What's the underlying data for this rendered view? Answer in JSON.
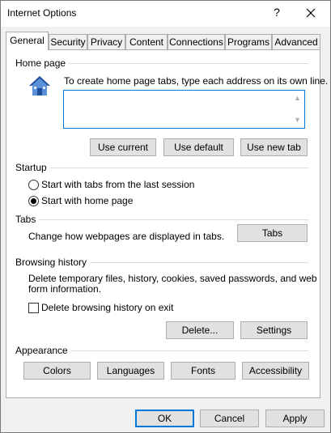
{
  "window": {
    "title": "Internet Options",
    "help_glyph": "?"
  },
  "tabs": [
    {
      "label": "General",
      "active": true
    },
    {
      "label": "Security"
    },
    {
      "label": "Privacy"
    },
    {
      "label": "Content"
    },
    {
      "label": "Connections"
    },
    {
      "label": "Programs"
    },
    {
      "label": "Advanced"
    }
  ],
  "home_page": {
    "group_label": "Home page",
    "instruction": "To create home page tabs, type each address on its own line.",
    "address_value": "",
    "buttons": {
      "use_current": "Use current",
      "use_default": "Use default",
      "use_new_tab": "Use new tab"
    }
  },
  "startup": {
    "group_label": "Startup",
    "option_last_session": "Start with tabs from the last session",
    "option_home_page": "Start with home page",
    "selected": "home_page"
  },
  "tabs_section": {
    "group_label": "Tabs",
    "description": "Change how webpages are displayed in tabs.",
    "button": "Tabs"
  },
  "browsing_history": {
    "group_label": "Browsing history",
    "description_line1": "Delete temporary files, history, cookies, saved passwords, and web",
    "description_line2": "form information.",
    "checkbox_label": "Delete browsing history on exit",
    "checked": false,
    "delete_button": "Delete...",
    "settings_button": "Settings"
  },
  "appearance": {
    "group_label": "Appearance",
    "buttons": {
      "colors": "Colors",
      "languages": "Languages",
      "fonts": "Fonts",
      "accessibility": "Accessibility"
    }
  },
  "footer": {
    "ok": "OK",
    "cancel": "Cancel",
    "apply": "Apply"
  },
  "colors": {
    "accent": "#0078d7",
    "house_roof": "#1f4e9c",
    "house_wall": "#5b8fd6"
  }
}
